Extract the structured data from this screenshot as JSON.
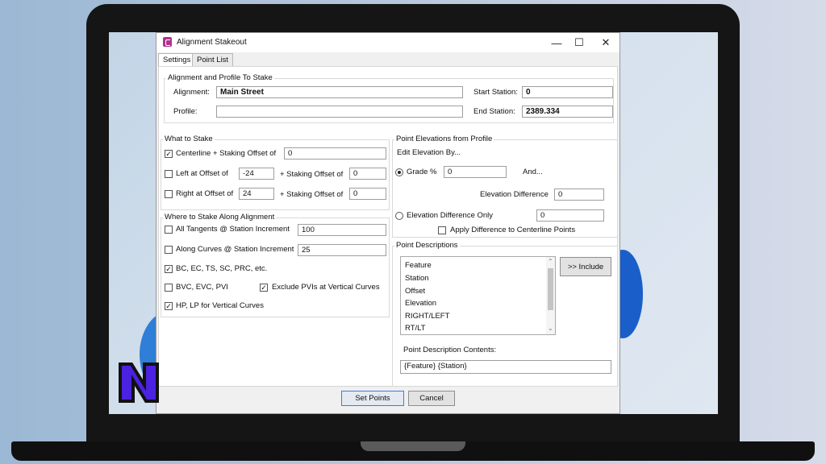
{
  "window": {
    "title": "Alignment Stakeout",
    "minimize": "—",
    "maximize": "☐",
    "close": "✕"
  },
  "tabs": [
    {
      "label": "Settings"
    },
    {
      "label": "Point List"
    }
  ],
  "alignment_group": {
    "title": "Alignment and Profile To Stake",
    "alignment_label": "Alignment:",
    "alignment_value": "Main Street",
    "profile_label": "Profile:",
    "profile_value": "",
    "start_label": "Start Station:",
    "start_value": "0",
    "end_label": "End Station:",
    "end_value": "2389.334"
  },
  "what_to_stake": {
    "title": "What to Stake",
    "centerline_label": "Centerline + Staking Offset of",
    "centerline_checked": true,
    "centerline_value": "0",
    "left_label": "Left at Offset of",
    "left_checked": false,
    "left_value": "-24",
    "left_staking_label": "+ Staking Offset of",
    "left_staking_value": "0",
    "right_label": "Right at Offset of",
    "right_checked": false,
    "right_value": "24",
    "right_staking_label": "+ Staking Offset of",
    "right_staking_value": "0"
  },
  "where_to_stake": {
    "title": "Where to Stake Along Alignment",
    "tangents_label": "All Tangents @ Station Increment",
    "tangents_checked": false,
    "tangents_value": "100",
    "curves_label": "Along Curves @ Station Increment",
    "curves_checked": false,
    "curves_value": "25",
    "bc_label": "BC, EC, TS, SC, PRC, etc.",
    "bc_checked": true,
    "bvc_label": "BVC, EVC, PVI",
    "bvc_checked": false,
    "exclude_label": "Exclude PVIs at Vertical Curves",
    "exclude_checked": true,
    "hp_label": "HP, LP for Vertical Curves",
    "hp_checked": true
  },
  "elevations": {
    "title": "Point Elevations from Profile",
    "edit_label": "Edit Elevation By...",
    "grade_label": "Grade %",
    "grade_selected": true,
    "grade_value": "0",
    "and_label": "And...",
    "elev_diff_label": "Elevation Difference",
    "elev_diff_value": "0",
    "diff_only_label": "Elevation Difference Only",
    "diff_only_selected": false,
    "diff_only_value": "0",
    "apply_label": "Apply Difference to Centerline Points",
    "apply_checked": false
  },
  "descriptions": {
    "title": "Point Descriptions",
    "items": [
      "Feature",
      "Station",
      "Offset",
      "Elevation",
      "RIGHT/LEFT",
      "RT/LT"
    ],
    "include_label": ">> Include",
    "contents_label": "Point Description Contents:",
    "contents_value": "{Feature} {Station}"
  },
  "footer": {
    "set_points_label": "Set Points",
    "cancel_label": "Cancel"
  },
  "brand": {
    "logo_letter": "N",
    "logo_color": "#4a22e0"
  },
  "colors": {
    "app_icon": "#b0338c",
    "primary_border": "#3a7fd5"
  }
}
